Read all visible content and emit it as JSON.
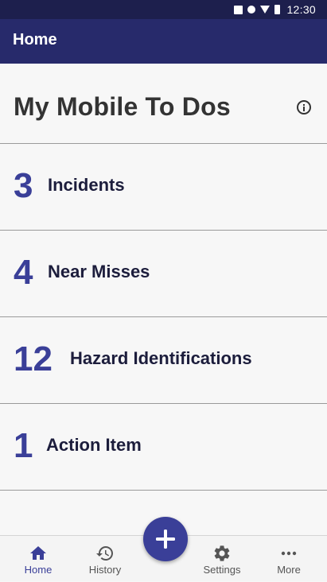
{
  "status_bar": {
    "time": "12:30",
    "icons": [
      "notification-square-icon",
      "notification-circle-icon",
      "wifi-icon",
      "battery-icon"
    ]
  },
  "app_bar": {
    "title": "Home"
  },
  "page": {
    "title": "My Mobile To Dos",
    "info_icon": "info-icon"
  },
  "todos": [
    {
      "count": "3",
      "label": "Incidents"
    },
    {
      "count": "4",
      "label": "Near Misses"
    },
    {
      "count": "12",
      "label": "Hazard Identifications"
    },
    {
      "count": "1",
      "label": "Action Item"
    }
  ],
  "fab": {
    "icon": "plus-icon"
  },
  "bottom_nav": {
    "items": [
      {
        "label": "Home",
        "icon": "home-icon",
        "active": true
      },
      {
        "label": "History",
        "icon": "history-icon",
        "active": false
      },
      {
        "label": "Settings",
        "icon": "gear-icon",
        "active": false
      },
      {
        "label": "More",
        "icon": "more-dots-icon",
        "active": false
      }
    ]
  },
  "colors": {
    "status_bar": "#1d1f4d",
    "app_bar": "#272a6b",
    "accent": "#3a3f98",
    "background": "#f7f7f7",
    "label_text": "#1c1d3c",
    "divider": "#9a9a9a"
  }
}
